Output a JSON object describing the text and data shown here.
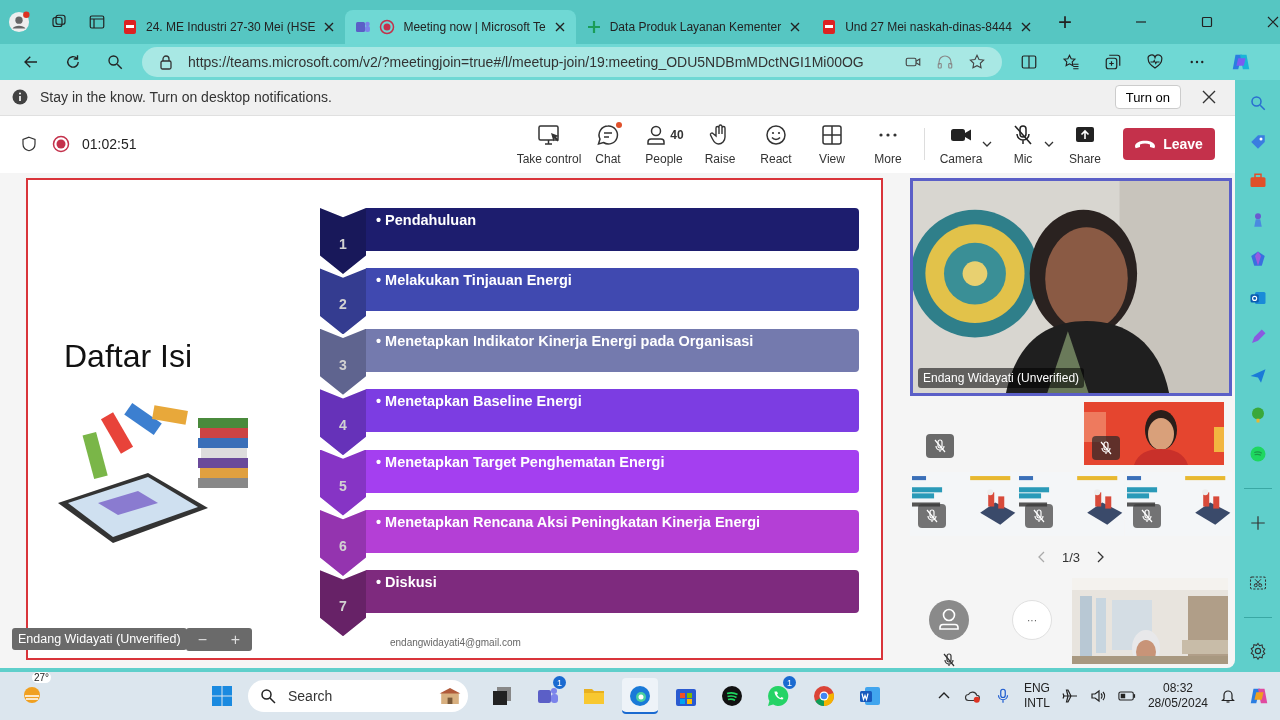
{
  "browser": {
    "tabs": [
      {
        "title": "24. ME Industri 27-30 Mei (HSE",
        "kind": "pdf",
        "selected": false
      },
      {
        "title": "Meeting now | Microsoft Te",
        "kind": "teams",
        "selected": true
      },
      {
        "title": "Data Produk Layanan Kementer",
        "kind": "sheet",
        "selected": false
      },
      {
        "title": "Und 27 Mei naskah-dinas-8444",
        "kind": "pdf",
        "selected": false
      }
    ],
    "new_tab": "+",
    "url": "https://teams.microsoft.com/v2/?meetingjoin=true#/l/meetup-join/19:meeting_ODU5NDBmMDctNGI1Mi00OG"
  },
  "notification": {
    "text": "Stay in the know. Turn on desktop notifications.",
    "button": "Turn on"
  },
  "meeting": {
    "recording": true,
    "timer": "01:02:51"
  },
  "toolbar": [
    {
      "kind": "take-control",
      "label": "Take control",
      "unread": false
    },
    {
      "kind": "chat",
      "label": "Chat",
      "unread": true
    },
    {
      "kind": "people",
      "label": "People",
      "count": "40",
      "unread": false
    },
    {
      "kind": "raise",
      "label": "Raise",
      "unread": false
    },
    {
      "kind": "react",
      "label": "React",
      "unread": false
    },
    {
      "kind": "view",
      "label": "View",
      "unread": false
    },
    {
      "kind": "more",
      "label": "More",
      "unread": false
    }
  ],
  "devices": [
    {
      "kind": "camera",
      "label": "Camera",
      "muted": false
    },
    {
      "kind": "mic",
      "label": "Mic",
      "muted": true
    }
  ],
  "share_label": "Share",
  "leave_button": "Leave",
  "slide": {
    "title": "Daftar Isi",
    "items": [
      {
        "number": "1",
        "text": "• Pendahuluan",
        "color": "#1d1d6e"
      },
      {
        "number": "2",
        "text": "• Melakukan Tinjauan Energi",
        "color": "#4049b0"
      },
      {
        "number": "3",
        "text": "• Menetapkan Indikator Kinerja Energi pada Organisasi",
        "color": "#747aae"
      },
      {
        "number": "4",
        "text": "• Menetapkan Baseline Energi",
        "color": "#7c3de2"
      },
      {
        "number": "5",
        "text": "• Menetapkan Target Penghematan Energi",
        "color": "#a43ff0"
      },
      {
        "number": "6",
        "text": "• Menetapkan Rencana Aksi Peningkatan Kinerja Energi",
        "color": "#b43fd6"
      },
      {
        "number": "7",
        "text": "• Diskusi",
        "color": "#7e2a7e"
      }
    ],
    "footer": "endangwidayati4@gmail.com"
  },
  "stage_label": "Endang Widayati (Unverified)",
  "zoom": {
    "out": "−",
    "in": "+"
  },
  "videos": {
    "main_name": "Endang Widayati (Unverified)",
    "pager": "1/3",
    "more_button": "···"
  },
  "taskbar": {
    "weather": "27°",
    "search_placeholder": "Search",
    "apps": [
      {
        "kind": "task-view",
        "selected": false
      },
      {
        "kind": "teams",
        "badge": "1",
        "selected": false
      },
      {
        "kind": "explorer",
        "selected": false
      },
      {
        "kind": "edge",
        "selected": true
      },
      {
        "kind": "store",
        "selected": false
      },
      {
        "kind": "spotify",
        "selected": false
      },
      {
        "kind": "whatsapp",
        "badge": "1",
        "selected": false
      },
      {
        "kind": "chrome",
        "selected": false
      },
      {
        "kind": "word",
        "selected": false
      }
    ],
    "language": "ENG",
    "layout": "INTL",
    "time": "08:32",
    "date": "28/05/2024"
  }
}
